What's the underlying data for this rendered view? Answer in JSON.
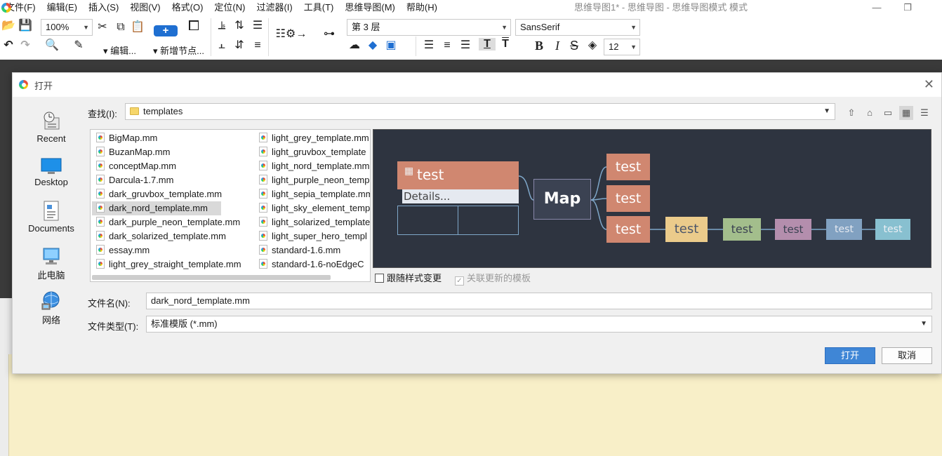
{
  "window": {
    "title": "思维导图1* - 思维导图 - 思维导图模式 模式",
    "minimize_label": "—",
    "maximize_label": "❐"
  },
  "menu": [
    "文件(F)",
    "编辑(E)",
    "插入(S)",
    "视图(V)",
    "格式(O)",
    "定位(N)",
    "过滤器(I)",
    "工具(T)",
    "思维导图(M)",
    "帮助(H)"
  ],
  "toolbar": {
    "zoom_value": "100%",
    "edit_label": "▾ 编辑...",
    "new_node_label": "▾ 新增节点...",
    "level_value": "第 3 层",
    "font_value": "SansSerif",
    "font_size_value": "12"
  },
  "dialog": {
    "title": "打开",
    "places": [
      {
        "label": "Recent",
        "icon": "recent-icon"
      },
      {
        "label": "Desktop",
        "icon": "desktop-icon"
      },
      {
        "label": "Documents",
        "icon": "documents-icon"
      },
      {
        "label": "此电脑",
        "icon": "computer-icon"
      },
      {
        "label": "网络",
        "icon": "network-icon"
      }
    ],
    "lookin_label": "查找(I):",
    "lookin_value": "templates",
    "files_col1": [
      "BigMap.mm",
      "BuzanMap.mm",
      "conceptMap.mm",
      "Darcula-1.7.mm",
      "dark_gruvbox_template.mm",
      "dark_nord_template.mm",
      "dark_purple_neon_template.mm",
      "dark_solarized_template.mm",
      "essay.mm",
      "light_grey_straight_template.mm"
    ],
    "files_col2": [
      "light_grey_template.mm",
      "light_gruvbox_template",
      "light_nord_template.mm",
      "light_purple_neon_temp",
      "light_sepia_template.mm",
      "light_sky_element_temp",
      "light_solarized_template",
      "light_super_hero_templ",
      "standard-1.6.mm",
      "standard-1.6-noEdgeC"
    ],
    "selected_file": "dark_nord_template.mm",
    "preview": {
      "details_label": "Details...",
      "center_label": "Map",
      "node_label": "test"
    },
    "follow_style_label": "跟随样式变更",
    "follow_style_checked": false,
    "link_template_label": "关联更新的模板",
    "link_template_checked": true,
    "filename_label": "文件名(N):",
    "filename_value": "dark_nord_template.mm",
    "filetype_label": "文件类型(T):",
    "filetype_value": "标准模版 (*.mm)",
    "open_button": "打开",
    "cancel_button": "取消"
  },
  "colors": {
    "accent": "#3f86d6",
    "preview_bg": "#2e3440",
    "node_salmon": "#d08770",
    "node_yellow": "#ebcb8b",
    "node_green": "#a3be8c",
    "node_purple": "#b48ead",
    "node_blue": "#81a1c1",
    "node_cyan": "#88c0d0"
  }
}
